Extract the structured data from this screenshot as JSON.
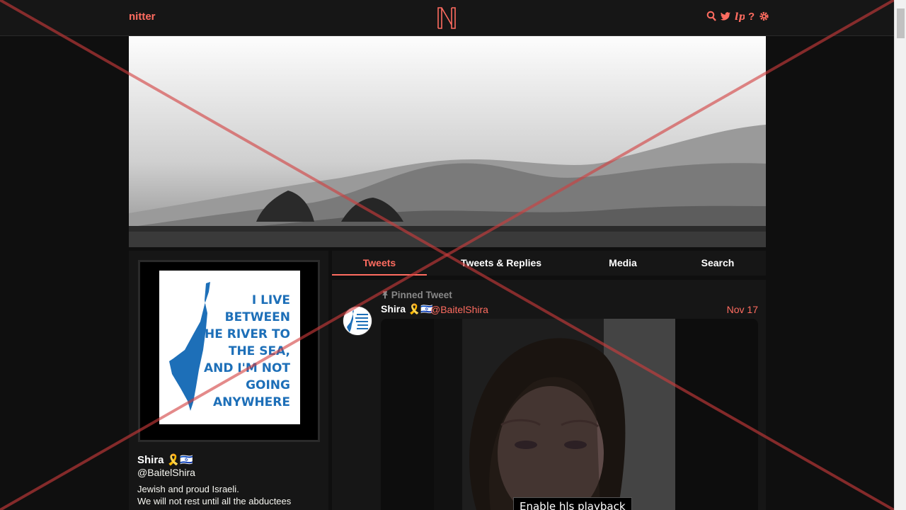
{
  "nav": {
    "brand": "nitter",
    "logo_letter": "N",
    "icons": [
      "search-icon",
      "twitter-icon",
      "liberapay-icon",
      "help-icon",
      "settings-icon"
    ]
  },
  "profile": {
    "name": "Shira 🎗️🇮🇱",
    "handle": "@BaitelShira",
    "bio_line1": "Jewish and proud Israeli.",
    "bio_line2": "We will not rest until all the abductees",
    "avatar_text": [
      "I LIVE",
      "BETWEEN",
      "THE RIVER TO",
      "THE SEA,",
      "AND I'M NOT",
      "GOING",
      "ANYWHERE"
    ]
  },
  "tabs": [
    {
      "label": "Tweets",
      "active": true
    },
    {
      "label": "Tweets & Replies",
      "active": false
    },
    {
      "label": "Media",
      "active": false
    },
    {
      "label": "Search",
      "active": false
    }
  ],
  "tweet": {
    "pinned_label": "Pinned Tweet",
    "name": "Shira 🎗️🇮🇱",
    "handle": "@BaitelShira",
    "date": "Nov 17",
    "hls_button": "Enable hls playback"
  },
  "colors": {
    "accent": "#ff6c60",
    "background": "#0f0f0f",
    "panel": "#161616",
    "map_blue": "#1d6fb8"
  }
}
